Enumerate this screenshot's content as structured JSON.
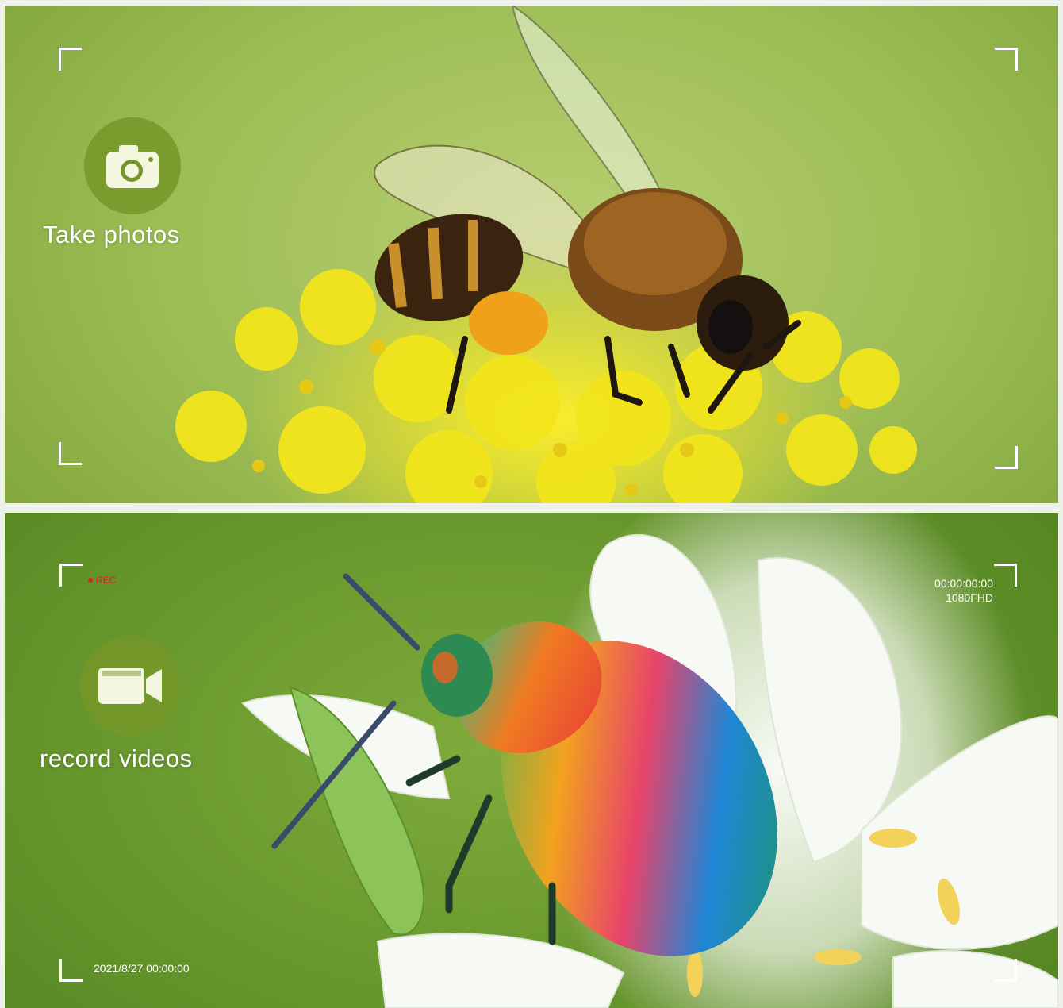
{
  "photo_panel": {
    "caption": "Take photos",
    "icon": "camera-icon"
  },
  "video_panel": {
    "caption": "record videos",
    "icon": "video-camera-icon",
    "rec_label": "REC",
    "timecode": "00:00:00:00",
    "resolution": "1080FHD",
    "datetime": "2021/8/27 00:00:00"
  },
  "colors": {
    "badge_green": "#76962a",
    "rec_red": "#e02020",
    "overlay_white": "#ffffff"
  }
}
